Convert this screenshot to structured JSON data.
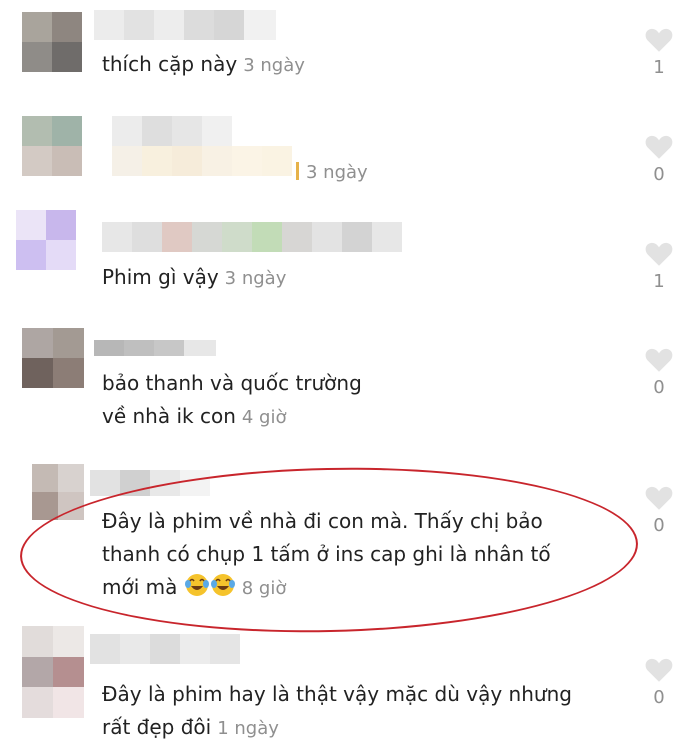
{
  "comments": [
    {
      "text": "thích cặp này",
      "time": "3 ngày",
      "likes": "1"
    },
    {
      "text": "",
      "time": "3 ngày",
      "likes": "0"
    },
    {
      "text": "Phim gì vậy",
      "time": "3 ngày",
      "likes": "1"
    },
    {
      "text_line1": "bảo thanh và quốc trường",
      "text_line2": "về nhà ik con",
      "time": "4 giờ",
      "likes": "0"
    },
    {
      "text_line1": "Đây là phim về nhà đi con mà. Thấy chị bảo",
      "text_line2": "thanh có chụp 1 tấm ở ins cap ghi là nhân tố",
      "text_line3": "mới mà",
      "emojis": [
        "face-with-tears-of-joy",
        "face-with-tears-of-joy"
      ],
      "time": "8 giờ",
      "likes": "0"
    },
    {
      "text_line1": "Đây là phim hay là thật vậy mặc dù vậy nhưng",
      "text_line2": "rất đẹp đôi",
      "time": "1 ngày",
      "likes": "0"
    }
  ],
  "colors": {
    "highlight": "#c8252c",
    "heart": "#e2e2e2",
    "meta": "#8f8f8f"
  },
  "icons": {
    "like": "heart-icon"
  }
}
